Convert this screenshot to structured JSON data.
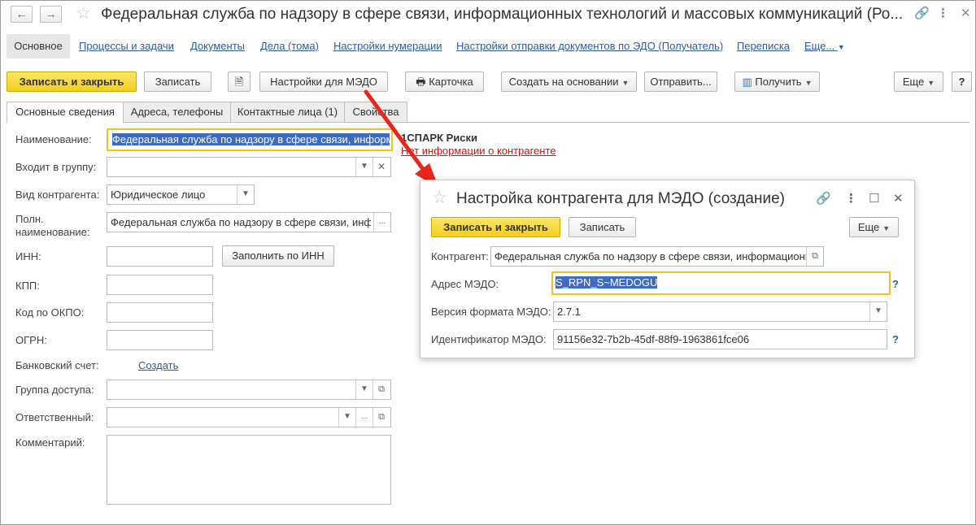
{
  "window": {
    "title": "Федеральная служба по надзору в сфере связи, информационных технологий и массовых коммуникаций (Ро...",
    "back_glyph": "←",
    "forward_glyph": "→"
  },
  "nav": {
    "main": "Основное",
    "links": [
      "Процессы и задачи",
      "Документы",
      "Дела (тома)",
      "Настройки нумерации",
      "Настройки отправки документов по ЭДО (Получатель)",
      "Переписка",
      "Еще..."
    ]
  },
  "toolbar": {
    "save_close": "Записать и закрыть",
    "save": "Записать",
    "medo_settings": "Настройки для МЭДО",
    "card": "Карточка",
    "create_based": "Создать на основании",
    "send": "Отправить...",
    "receive": "Получить",
    "more": "Еще",
    "help": "?"
  },
  "tabs": [
    "Основные сведения",
    "Адреса, телефоны",
    "Контактные лица (1)",
    "Свойства"
  ],
  "form": {
    "name_label": "Наименование:",
    "name_value": "Федеральная служба по надзору в сфере связи, информ",
    "group_label": "Входит в группу:",
    "type_label": "Вид контрагента:",
    "type_value": "Юридическое лицо",
    "full_name_label": "Полн. наименование:",
    "full_name_value": "Федеральная служба по надзору в сфере связи, инф",
    "inn_label": "ИНН:",
    "fill_by_inn": "Заполнить по ИНН",
    "kpp_label": "КПП:",
    "okpo_label": "Код по ОКПО:",
    "ogrn_label": "ОГРН:",
    "bank_label": "Банковский счет:",
    "bank_create": "Создать",
    "access_label": "Группа доступа:",
    "responsible_label": "Ответственный:",
    "comment_label": "Комментарий:"
  },
  "spark": {
    "title": "1СПАРК Риски",
    "link": "Нет информации о контрагенте"
  },
  "dialog": {
    "title": "Настройка контрагента для МЭДО (создание)",
    "save_close": "Записать и закрыть",
    "save": "Записать",
    "more": "Еще",
    "contractor_label": "Контрагент:",
    "contractor_value": "Федеральная служба по надзору в сфере связи, информационны",
    "address_label": "Адрес МЭДО:",
    "address_value": "S_RPN_S~MEDOGU",
    "format_label": "Версия формата МЭДО:",
    "format_value": "2.7.1",
    "id_label": "Идентификатор МЭДО:",
    "id_value": "91156e32-7b2b-45df-88f9-1963861fce06",
    "help": "?"
  },
  "colors": {
    "accent_yellow": "#f3cf1b",
    "link_blue": "#2f5c9e",
    "arrow_red": "#e8261b",
    "selection_blue": "#3d6bc4"
  }
}
